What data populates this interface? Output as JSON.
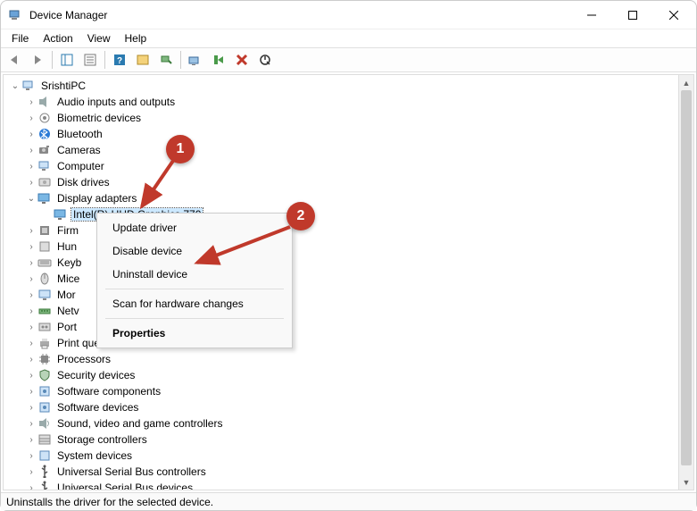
{
  "window": {
    "title": "Device Manager"
  },
  "menu": {
    "items": [
      "File",
      "Action",
      "View",
      "Help"
    ]
  },
  "toolbar": {
    "icons": [
      "back-icon",
      "forward-icon",
      "show-hide-tree-icon",
      "properties-icon",
      "help-icon",
      "action-icon",
      "scan-icon",
      "update-icon",
      "uninstall-icon",
      "disable-icon",
      "add-legacy-icon"
    ]
  },
  "tree": {
    "root": {
      "label": "SrishtiPC",
      "expanded": true
    },
    "items": [
      {
        "label": "Audio inputs and outputs",
        "icon": "audio"
      },
      {
        "label": "Biometric devices",
        "icon": "biometric"
      },
      {
        "label": "Bluetooth",
        "icon": "bluetooth"
      },
      {
        "label": "Cameras",
        "icon": "camera"
      },
      {
        "label": "Computer",
        "icon": "computer"
      },
      {
        "label": "Disk drives",
        "icon": "disk"
      },
      {
        "label": "Display adapters",
        "icon": "display",
        "expanded": true,
        "children": [
          {
            "label": "Intel(R) UHD Graphics 770",
            "icon": "display",
            "selected": true
          }
        ]
      },
      {
        "label": "Firmware",
        "icon": "firmware",
        "truncated": "Firm"
      },
      {
        "label": "Human Interface Devices",
        "icon": "hid",
        "truncated": "Hun"
      },
      {
        "label": "Keyboards",
        "icon": "keyboard",
        "truncated": "Keyb"
      },
      {
        "label": "Mice and other pointing devices",
        "icon": "mouse",
        "truncated": "Mice"
      },
      {
        "label": "Monitors",
        "icon": "monitor",
        "truncated": "Mor"
      },
      {
        "label": "Network adapters",
        "icon": "network",
        "truncated": "Netv"
      },
      {
        "label": "Ports (COM & LPT)",
        "icon": "ports",
        "truncated": "Port"
      },
      {
        "label": "Print queues",
        "icon": "printer"
      },
      {
        "label": "Processors",
        "icon": "processor"
      },
      {
        "label": "Security devices",
        "icon": "security"
      },
      {
        "label": "Software components",
        "icon": "software"
      },
      {
        "label": "Software devices",
        "icon": "software"
      },
      {
        "label": "Sound, video and game controllers",
        "icon": "sound"
      },
      {
        "label": "Storage controllers",
        "icon": "storage"
      },
      {
        "label": "System devices",
        "icon": "system"
      },
      {
        "label": "Universal Serial Bus controllers",
        "icon": "usb"
      },
      {
        "label": "Universal Serial Bus devices",
        "icon": "usb"
      }
    ]
  },
  "context_menu": {
    "items": [
      {
        "label": "Update driver",
        "type": "item"
      },
      {
        "label": "Disable device",
        "type": "item"
      },
      {
        "label": "Uninstall device",
        "type": "item"
      },
      {
        "type": "sep"
      },
      {
        "label": "Scan for hardware changes",
        "type": "item"
      },
      {
        "type": "sep"
      },
      {
        "label": "Properties",
        "type": "item",
        "bold": true
      }
    ]
  },
  "status": {
    "text": "Uninstalls the driver for the selected device."
  },
  "callouts": {
    "one": "1",
    "two": "2"
  }
}
